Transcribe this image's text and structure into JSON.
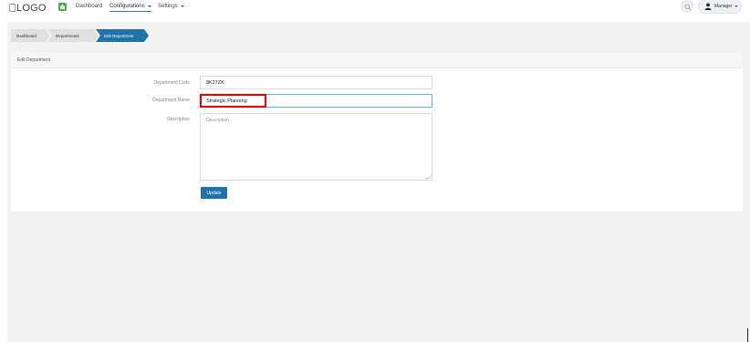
{
  "header": {
    "logo_text": "LOGO",
    "nav": {
      "dashboard": "Dashboard",
      "configurations": "Configurations",
      "settings": "Settings"
    },
    "search_icon": "search-icon",
    "user": {
      "label": "Manager",
      "icon": "user-icon"
    }
  },
  "breadcrumb": {
    "items": [
      "Dashboard",
      "Departments",
      "Edit Department"
    ]
  },
  "panel": {
    "title": "Edit Department"
  },
  "form": {
    "code": {
      "label": "Department Code",
      "value": "8K27ZK"
    },
    "name": {
      "label": "Department Name",
      "value": "Strategic Planning"
    },
    "description": {
      "label": "Description",
      "placeholder": "Description",
      "value": ""
    },
    "submit_label": "Update"
  },
  "colors": {
    "primary": "#1f73a8",
    "highlight": "#e60000",
    "home_icon": "#4caf50"
  }
}
